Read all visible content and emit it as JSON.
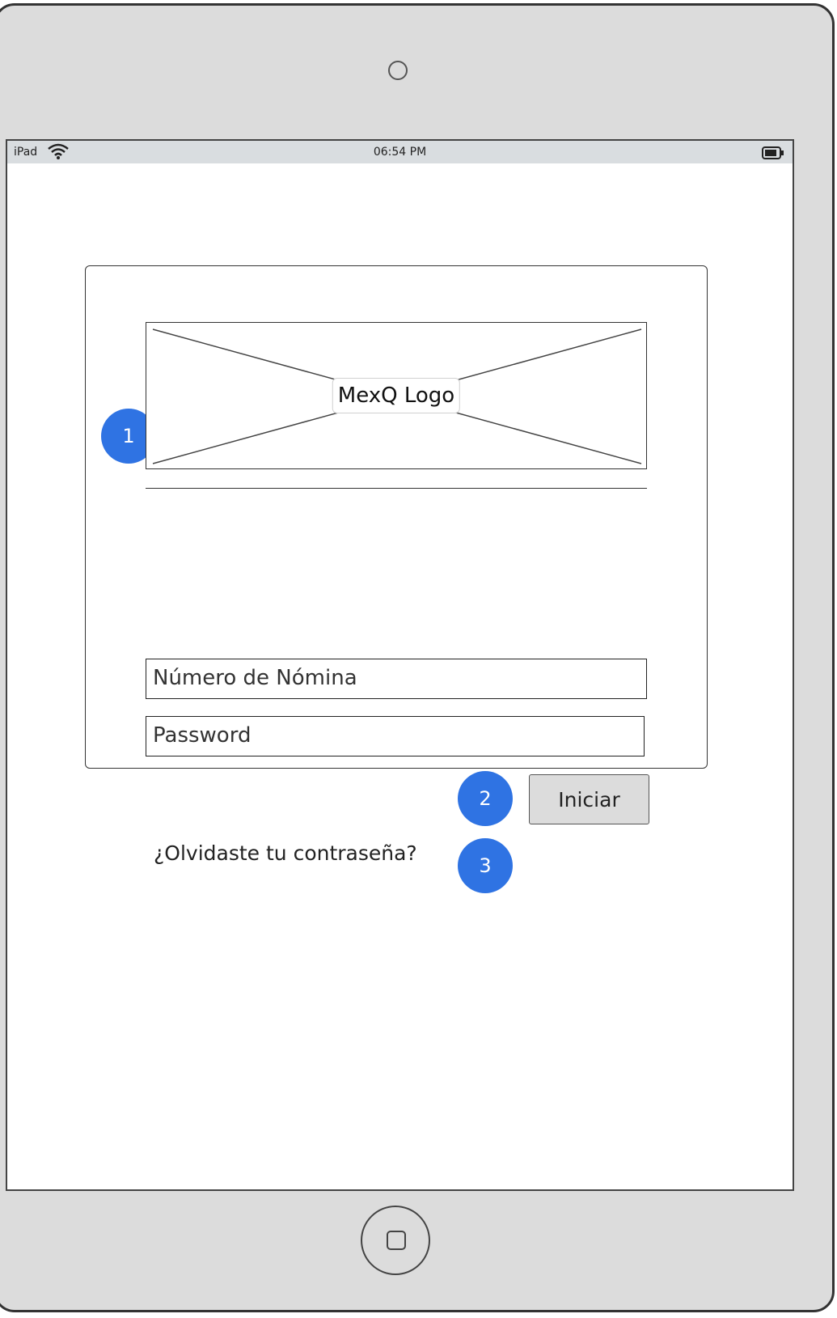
{
  "status_bar": {
    "carrier": "iPad",
    "time": "06:54 PM",
    "icons": [
      "wifi-icon",
      "battery-icon"
    ]
  },
  "login": {
    "logo_label": "MexQ Logo",
    "employee_number_placeholder": "Número de Nómina",
    "password_placeholder": "Password",
    "submit_label": "Iniciar",
    "forgot_password_label": "¿Olvidaste tu contraseña?"
  },
  "annotations": {
    "badge_1": "1",
    "badge_2": "2",
    "badge_3": "3",
    "color": "#2f73e3"
  },
  "device": {
    "frame_color": "#dcdcdc",
    "statusbar_color": "#d9dde0"
  }
}
